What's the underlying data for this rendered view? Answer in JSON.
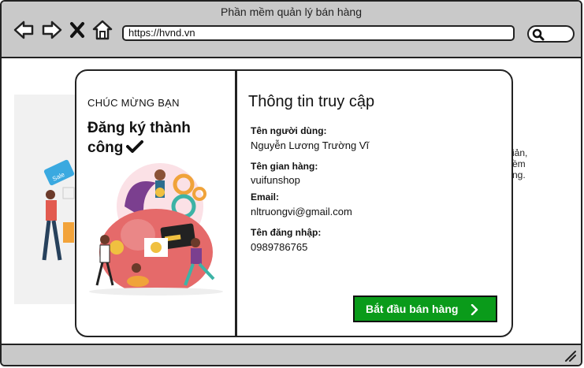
{
  "window": {
    "title": "Phần mềm quản lý bán hàng"
  },
  "nav": {
    "back_icon": "arrow-left-icon",
    "forward_icon": "arrow-right-icon",
    "close_icon": "close-icon",
    "home_icon": "home-icon"
  },
  "address_bar": {
    "url": "https://hvnd.vn"
  },
  "search": {
    "icon": "search-icon"
  },
  "background_text": {
    "lines": [
      "iản,",
      "ềm",
      "ng."
    ]
  },
  "modal": {
    "congrats": "CHÚC MỪNG BẠN",
    "heading": "Đăng ký thành công",
    "heading_icon": "checkmark-icon",
    "info_title": "Thông tin truy cập",
    "fields": [
      {
        "label": "Tên người dùng:",
        "value": "Nguyễn Lương Trường Vĩ"
      },
      {
        "label": "Tên gian hàng:",
        "value": "vuifunshop"
      },
      {
        "label": "Email:",
        "value": "nltruongvi@gmail.com"
      },
      {
        "label": "Tên đăng nhập:",
        "value": "0989786765"
      }
    ],
    "start_button": "Bắt đầu bán hàng"
  },
  "colors": {
    "accent_green": "#0a9b1a",
    "chrome_gray": "#c9c9c9"
  }
}
